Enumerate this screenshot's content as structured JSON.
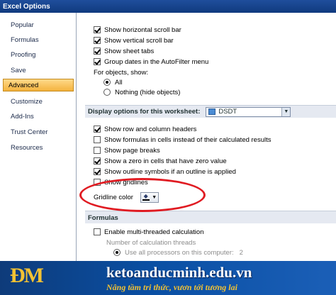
{
  "window": {
    "title": "Excel Options"
  },
  "sidebar": {
    "items": [
      {
        "label": "Popular"
      },
      {
        "label": "Formulas"
      },
      {
        "label": "Proofing"
      },
      {
        "label": "Save"
      },
      {
        "label": "Advanced",
        "active": true
      },
      {
        "label": "Customize"
      },
      {
        "label": "Add-Ins"
      },
      {
        "label": "Trust Center"
      },
      {
        "label": "Resources"
      }
    ]
  },
  "workbook_options": {
    "show_hscroll": {
      "label": "Show horizontal scroll bar",
      "checked": true
    },
    "show_vscroll": {
      "label": "Show vertical scroll bar",
      "checked": true
    },
    "show_tabs": {
      "label": "Show sheet tabs",
      "checked": true
    },
    "group_dates": {
      "label": "Group dates in the AutoFilter menu",
      "checked": true
    },
    "objects_label": "For objects, show:",
    "objects_all": {
      "label": "All",
      "selected": true
    },
    "objects_nothing": {
      "label": "Nothing (hide objects)",
      "selected": false
    }
  },
  "worksheet_section": {
    "title": "Display options for this worksheet:",
    "sheet_value": "DSDT"
  },
  "worksheet_options": {
    "row_col_headers": {
      "label": "Show row and column headers",
      "checked": true
    },
    "formulas_in_cells": {
      "label": "Show formulas in cells instead of their calculated results",
      "checked": false
    },
    "page_breaks": {
      "label": "Show page breaks",
      "checked": false
    },
    "zero_values": {
      "label": "Show a zero in cells that have zero value",
      "checked": true
    },
    "outline_symbols": {
      "label": "Show outline symbols if an outline is applied",
      "checked": true
    },
    "gridlines": {
      "label": "Show gridlines",
      "checked": false
    },
    "gridline_color_label": "Gridline color"
  },
  "formulas_section": {
    "title": "Formulas",
    "multithread": {
      "label": "Enable multi-threaded calculation",
      "checked": false
    },
    "threads_label": "Number of calculation threads",
    "use_all": {
      "label": "Use all processors on this computer:",
      "value": "2"
    }
  },
  "banner": {
    "logo": "ĐM",
    "site": "ketoanducminh.edu.vn",
    "slogan": "Nâng tầm tri thức, vươn tới tương lai"
  },
  "colors": {
    "highlight_ellipse": "#e01b22",
    "active_tab": "#f4b33e",
    "banner_blue": "#0a4fa3",
    "banner_gold": "#f3c233"
  }
}
